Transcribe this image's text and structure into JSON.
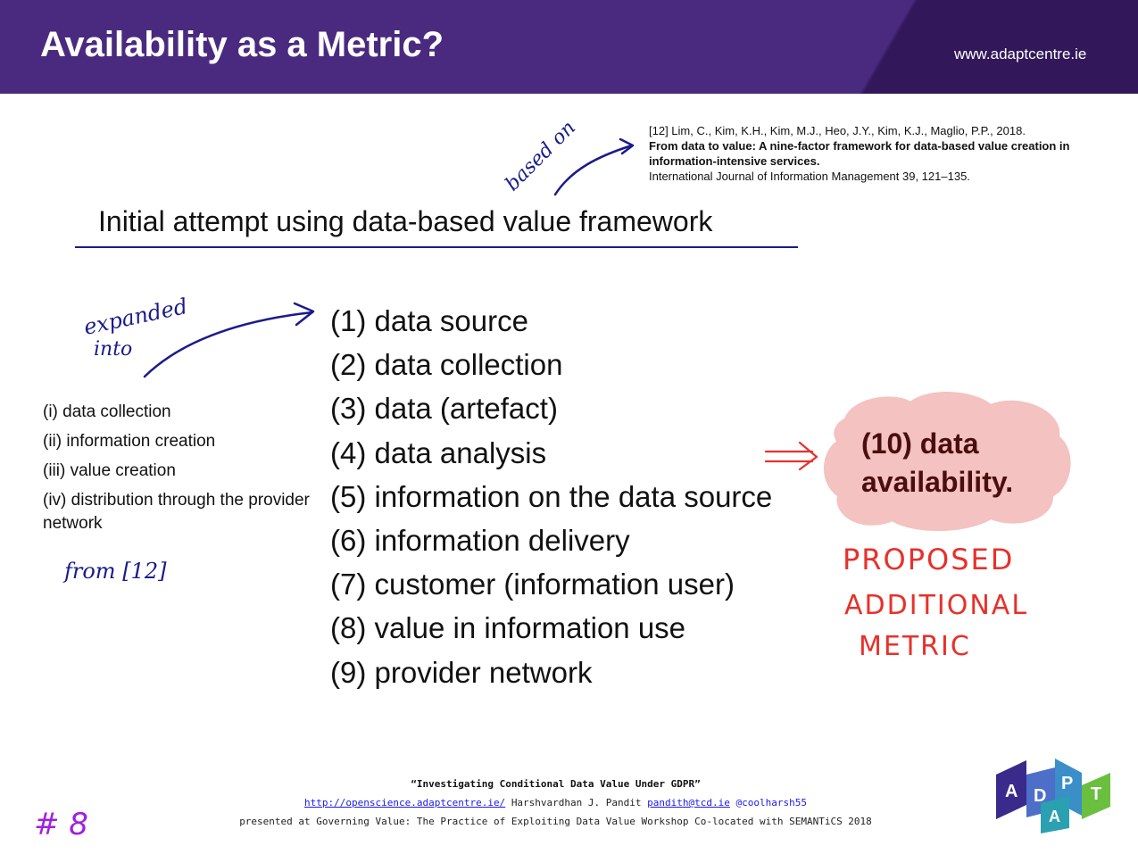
{
  "header": {
    "title": "Availability as a Metric?",
    "site": "www.adaptcentre.ie"
  },
  "reference": {
    "authors": "[12] Lim, C., Kim, K.H., Kim, M.J., Heo, J.Y., Kim, K.J., Maglio, P.P., 2018.",
    "title": "From data to value: A nine-factor framework for data-based value creation in information-intensive services.",
    "journal": "International Journal of Information Management 39, 121–135."
  },
  "subtitle": "Initial attempt using data-based value framework",
  "factors": [
    "(1) data source",
    "(2) data collection",
    "(3) data (artefact)",
    "(4) data analysis",
    "(5) information on the data source",
    "(6) information delivery",
    "(7) customer (information user)",
    "(8) value in information use",
    "(9) provider network"
  ],
  "stages": [
    "(i) data collection",
    "(ii) information creation",
    "(iii) value creation",
    "(iv) distribution through the provider network"
  ],
  "proposed": {
    "line1": "(10) data",
    "line2": "availability."
  },
  "handwriting": {
    "based_on": "based on",
    "expanded_into": "expanded into",
    "from_ref": "from [12]",
    "proposed_metric": [
      "PROPOSED",
      "ADDITIONAL",
      "METRIC"
    ],
    "slide_number": "# 8"
  },
  "footer": {
    "talk_title": "“Investigating Conditional Data Value Under GDPR”",
    "url": "http://openscience.adaptcentre.ie/",
    "author": "Harshvardhan J. Pandit",
    "email": "pandith@tcd.ie",
    "handle": "@coolharsh55",
    "venue": "presented at Governing Value: The Practice of Exploiting Data Value Workshop Co-located with SEMANTiCS 2018"
  },
  "logo": {
    "letters": [
      "A",
      "D",
      "P",
      "A",
      "T"
    ]
  },
  "colors": {
    "header": "#4a2a7f",
    "ink_blue": "#1a1a8c",
    "ink_red": "#e8302a",
    "ink_purple": "#a020e0",
    "cloud": "#f4c2c0"
  }
}
